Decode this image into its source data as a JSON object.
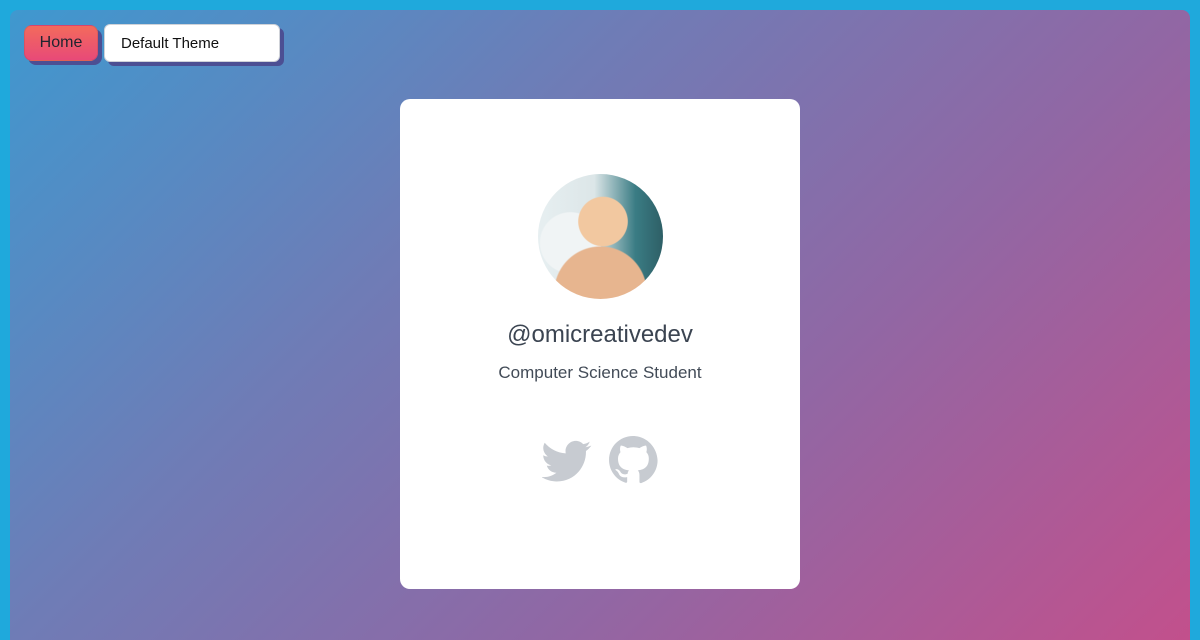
{
  "nav": {
    "home_label": "Home",
    "theme_value": "Default Theme"
  },
  "profile": {
    "username": "@omicreativedev",
    "subtitle": "Computer Science Student",
    "avatar_alt": "Profile photo"
  },
  "social": [
    {
      "name": "twitter",
      "icon": "twitter-icon"
    },
    {
      "name": "github",
      "icon": "github-icon"
    }
  ],
  "colors": {
    "page_background": "#1fa9dc",
    "gradient_start": "#3f98cf",
    "gradient_end": "#c2508c",
    "icon_gray": "#c7cbd1",
    "button_shadow": "#4c4f93",
    "home_button": "#ee5a70"
  }
}
